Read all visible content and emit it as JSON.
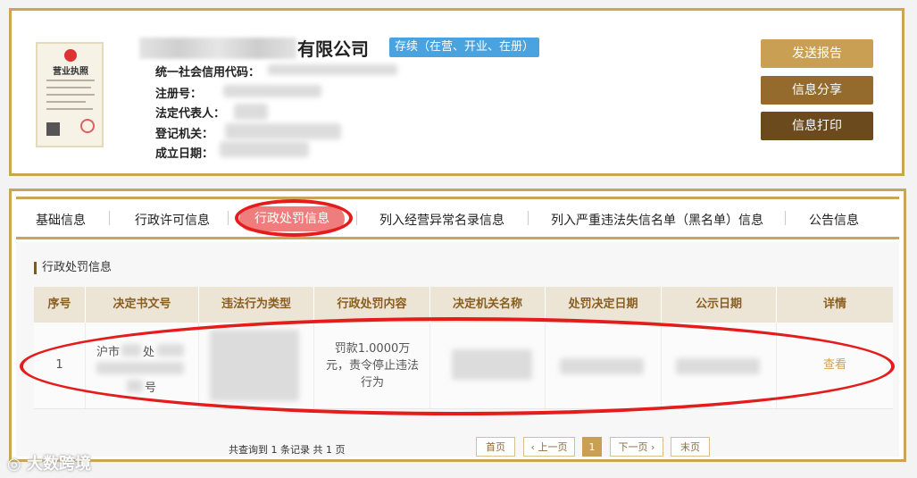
{
  "company": {
    "name_suffix": "有限公司",
    "status": "存续（在营、开业、在册）",
    "fields": [
      {
        "label": "统一社会信用代码："
      },
      {
        "label": "注册号："
      },
      {
        "label": "法定代表人："
      },
      {
        "label": "登记机关："
      },
      {
        "label": "成立日期："
      }
    ],
    "license_title": "营业执照"
  },
  "actions": {
    "send": "发送报告",
    "share": "信息分享",
    "print": "信息打印"
  },
  "tabs": [
    "基础信息",
    "行政许可信息",
    "行政处罚信息",
    "列入经营异常名录信息",
    "列入严重违法失信名单（黑名单）信息",
    "公告信息"
  ],
  "section_title": "行政处罚信息",
  "table": {
    "headers": [
      "序号",
      "决定书文号",
      "违法行为类型",
      "行政处罚内容",
      "决定机关名称",
      "处罚决定日期",
      "公示日期",
      "详情"
    ],
    "row": {
      "index": "1",
      "doc_no_prefix": "沪市",
      "doc_no_mid": "处",
      "doc_no_suffix": "号",
      "content": "罚款1.0000万元，责令停止违法行为",
      "detail": "查看"
    }
  },
  "pagination": {
    "summary": "共查询到 1 条记录 共 1 页",
    "first": "首页",
    "prev": "‹ 上一页",
    "current": "1",
    "next": "下一页 ›",
    "last": "末页"
  },
  "colors": {
    "gold_border": "#c9a656",
    "status_blue": "#4aa3df",
    "active_tab": "#f07d7d",
    "annotation_red": "#e41c1c"
  }
}
